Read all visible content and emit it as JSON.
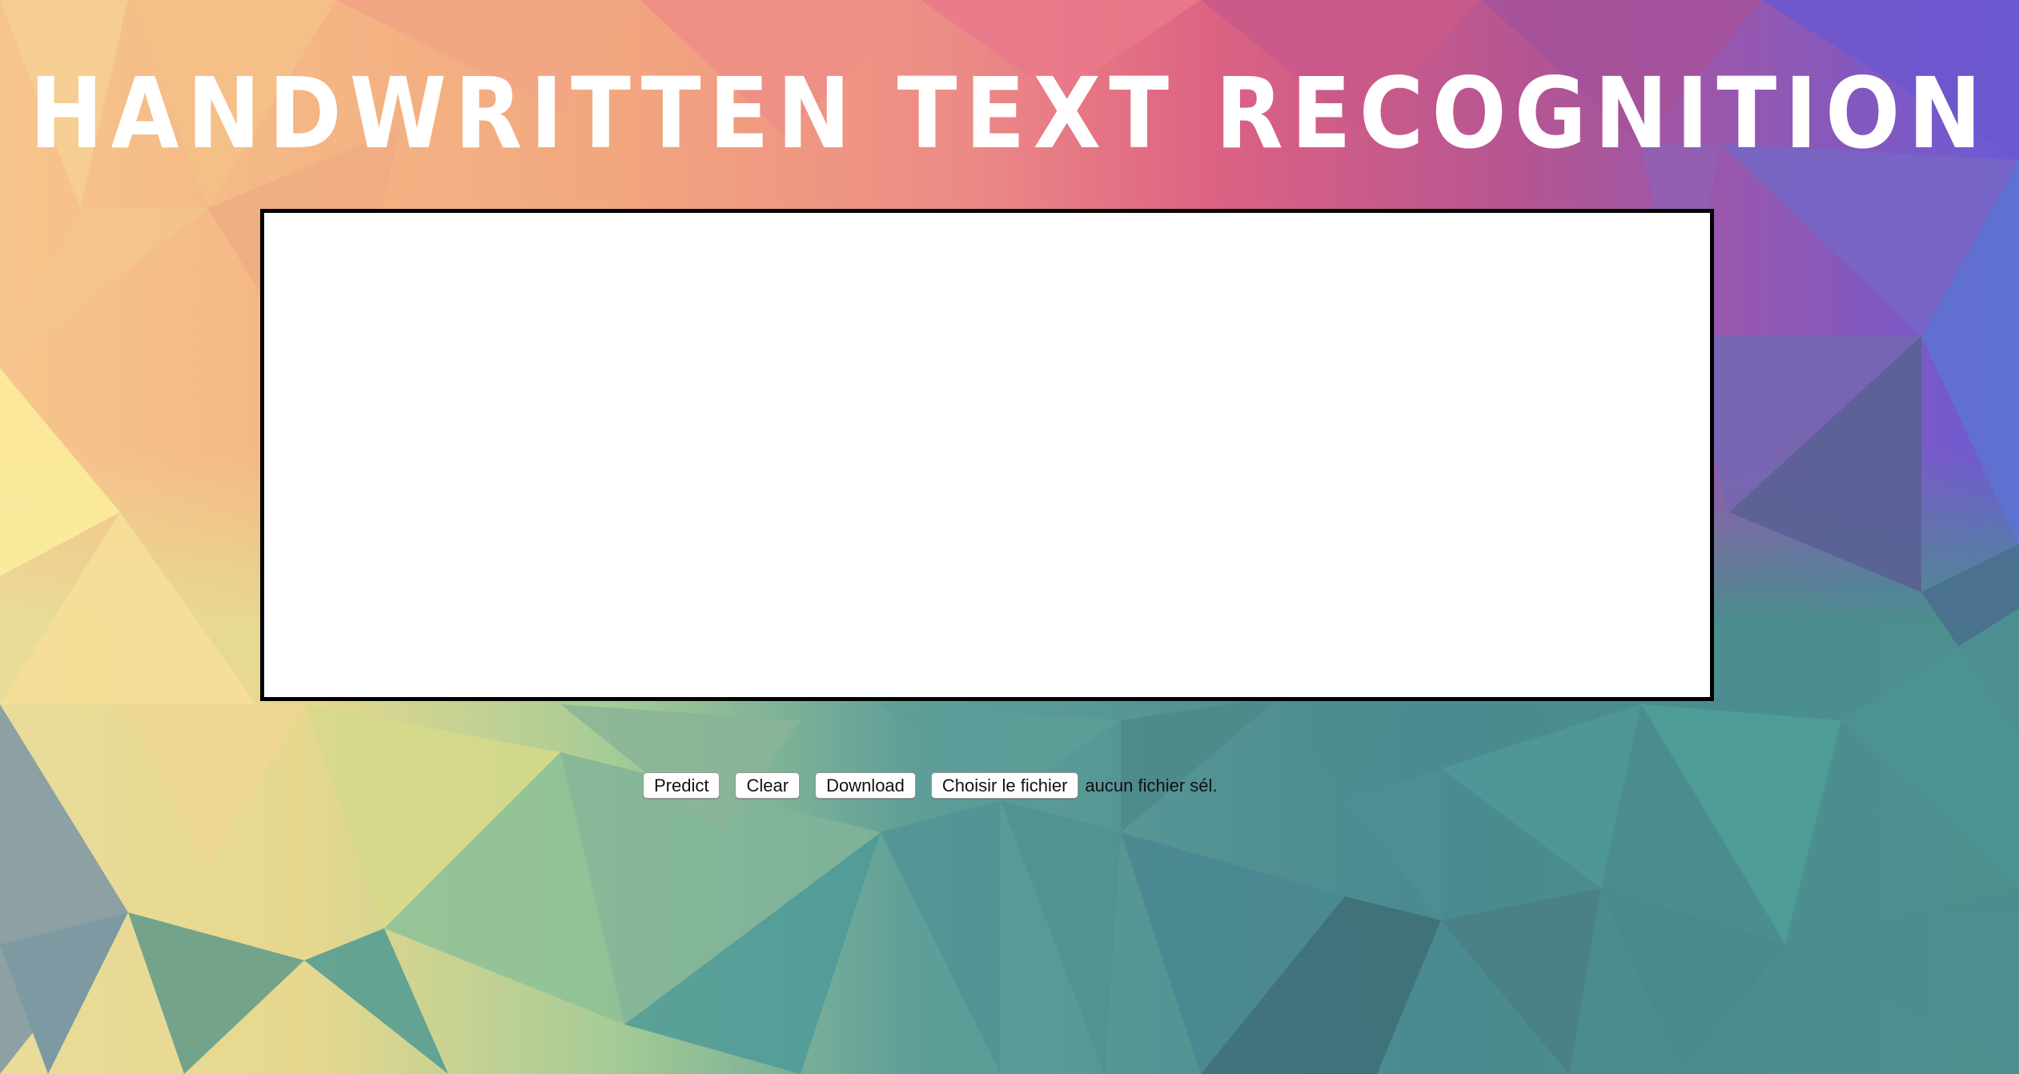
{
  "page": {
    "title": "HANDWRITTEN TEXT RECOGNITION"
  },
  "controls": {
    "predict_label": "Predict",
    "clear_label": "Clear",
    "download_label": "Download",
    "file_button_label": "Choisir le fichier",
    "file_status": "aucun fichier sél."
  },
  "colors": {
    "title": "#ffffff",
    "canvas_background": "#ffffff",
    "canvas_border": "#000000"
  }
}
